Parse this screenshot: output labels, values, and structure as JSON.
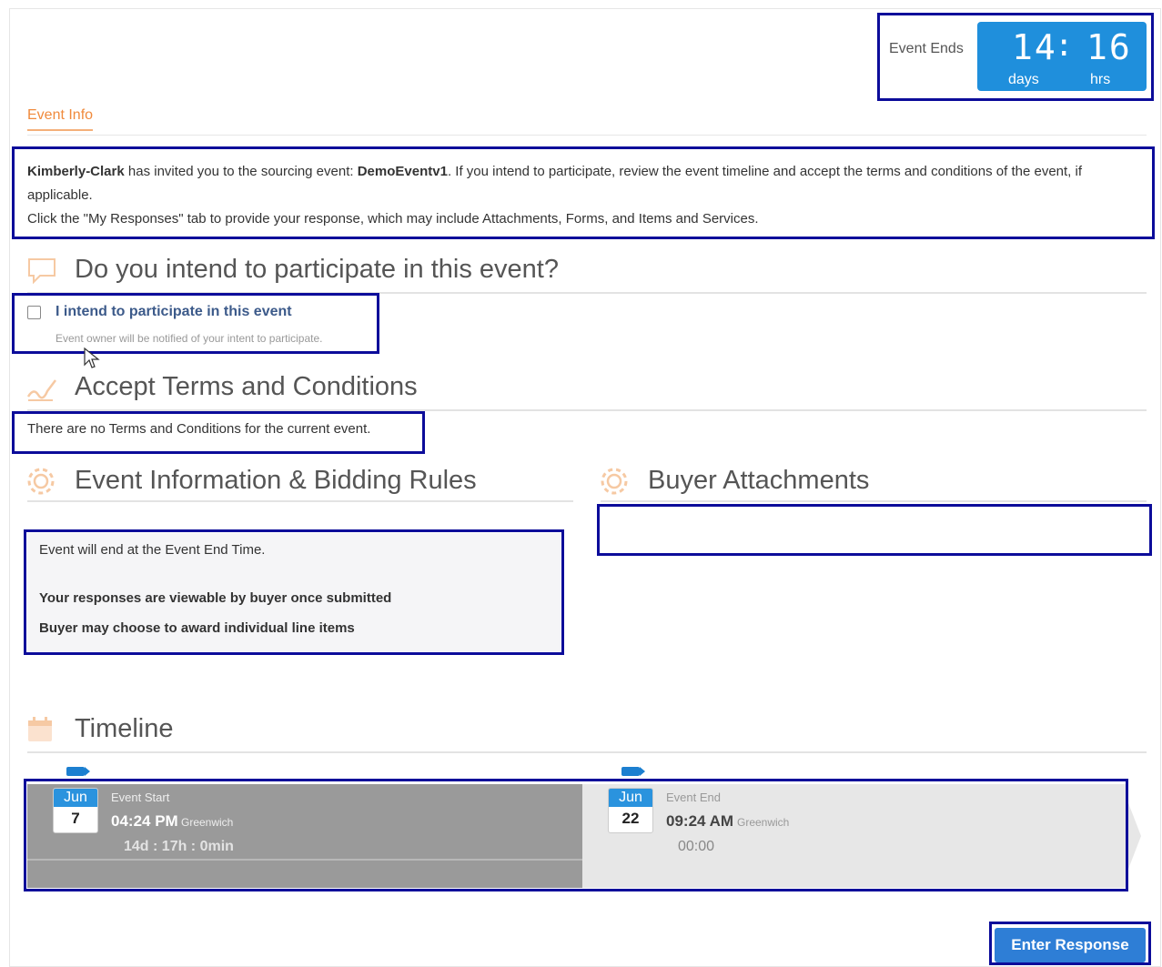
{
  "event_ends": {
    "label": "Event Ends",
    "days_value": "14",
    "separator": ":",
    "hrs_value": "16",
    "days_unit": "days",
    "hrs_unit": "hrs"
  },
  "tabs": [
    {
      "label": "Event Info",
      "active": true
    }
  ],
  "intro": {
    "buyer": "Kimberly-Clark",
    "text1": " has invited you to the sourcing event: ",
    "event_name": "DemoEventv1",
    "text2": ". If you intend to participate, review the event timeline and accept the terms and conditions of the event, if applicable.",
    "line2": "Click the \"My Responses\" tab to provide your response, which may include Attachments, Forms, and Items and Services."
  },
  "participate": {
    "title": "Do you intend to participate in this event?",
    "checkbox_label": "I intend to participate in this event",
    "checked": false,
    "note": "Event owner will be notified of your intent to participate."
  },
  "terms": {
    "title": "Accept Terms and Conditions",
    "text": "There are no Terms and Conditions for the current event."
  },
  "rules": {
    "title": "Event Information & Bidding Rules",
    "lines": [
      "Event will end at the Event End Time.",
      "Your responses are viewable by buyer once submitted",
      "Buyer may choose to award individual line items"
    ]
  },
  "attachments": {
    "title": "Buyer Attachments"
  },
  "timeline": {
    "title": "Timeline",
    "start": {
      "month": "Jun",
      "day": "7",
      "label": "Event Start",
      "time": "04:24 PM",
      "tz": "Greenwich",
      "remaining": "14d : 17h : 0min"
    },
    "end": {
      "month": "Jun",
      "day": "22",
      "label": "Event End",
      "time": "09:24 AM",
      "tz": "Greenwich",
      "remaining": "00:00"
    }
  },
  "actions": {
    "enter_response": "Enter Response"
  },
  "colors": {
    "accent_blue": "#1f8fdc",
    "tab_orange": "#f08a3c",
    "highlight_border": "#0c0c9a"
  }
}
